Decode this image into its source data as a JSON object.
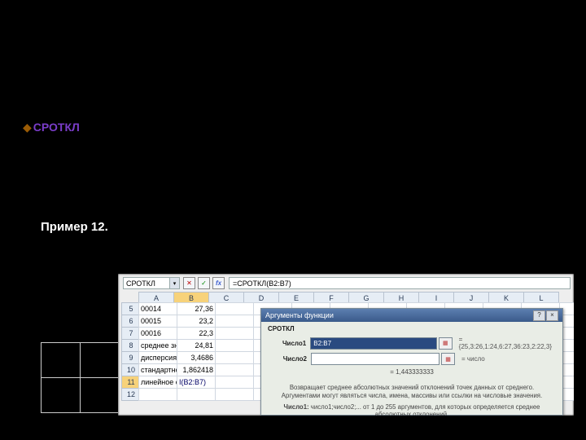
{
  "bullet": {
    "keyword": "СРОТКЛ"
  },
  "example": {
    "label": "Пример 12."
  },
  "sheet": {
    "nameBox": "СРОТКЛ",
    "formula": "=СРОТКЛ(B2:B7)",
    "columns": [
      "A",
      "B",
      "C",
      "D",
      "E",
      "F",
      "G",
      "H",
      "I",
      "J",
      "K",
      "L"
    ],
    "selColIndex": 1,
    "rows": [
      "5",
      "6",
      "7",
      "8",
      "9",
      "10",
      "11",
      "12"
    ],
    "selRowIndex": 6,
    "data": {
      "5": {
        "A": "00014",
        "B": "27,36"
      },
      "6": {
        "A": "00015",
        "B": "23,2"
      },
      "7": {
        "A": "00016",
        "B": "22,3"
      },
      "8": {
        "A": "среднее значение цены",
        "B": "24,81"
      },
      "9": {
        "A": "дисперсия",
        "B": "3,4686"
      },
      "10": {
        "A": "стандартное отклонение",
        "B": "1,862418"
      },
      "11": {
        "A": "линейное отклонение",
        "B": "I(B2:B7)"
      }
    }
  },
  "dialog": {
    "title": "Аргументы функции",
    "help": "?",
    "close": "×",
    "func": "СРОТКЛ",
    "arg1": {
      "label": "Число1",
      "value": "B2:B7",
      "expand": "= {25,3:26,1:24,6:27,36:23,2:22,3}"
    },
    "arg2": {
      "label": "Число2",
      "value": "",
      "expand": "= число"
    },
    "result": "=  1,443333333",
    "desc": "Возвращает среднее абсолютных значений отклонений точек данных от среднего. Аргументами могут являться числа, имена, массивы или ссылки на числовые значения.",
    "argHelpLabel": "Число1:",
    "argHelpText": "число1;число2;... от 1 до 255 аргументов, для которых определяется среднее абсолютных отклонений."
  }
}
